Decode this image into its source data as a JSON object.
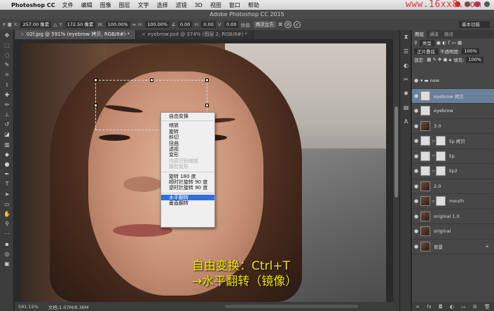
{
  "menubar": {
    "apple_icon": "apple-icon",
    "app_name": "Photoshop CC",
    "items": [
      "文件",
      "编辑",
      "图像",
      "图层",
      "文字",
      "选择",
      "滤镜",
      "3D",
      "视图",
      "窗口",
      "帮助"
    ],
    "watermark": "www.16xx8.com"
  },
  "titlebar": {
    "title": "Adobe Photoshop CC 2015"
  },
  "options": {
    "x_label": "X:",
    "x_value": "257.00 像素",
    "y_label": "Y:",
    "y_value": "172.50 像素",
    "w_label": "W:",
    "w_value": "100.00%",
    "h_label": "H:",
    "h_value": "100.00%",
    "angle_value": "0.00",
    "hs_label": "H:",
    "hs_value": "0.00",
    "v_label": "V:",
    "v_value": "0.00",
    "interp_label": "插值:",
    "interp_value": "两次立方",
    "workspace": "基本功能"
  },
  "tabs": [
    {
      "label": "02f.jpg @ 591% (eyebrow 拷贝, RGB/8#) *",
      "active": true
    },
    {
      "label": "eyebrow.psd @ 374% (图层 2, RGB/8#) *",
      "active": false
    }
  ],
  "context_menu": {
    "items": [
      {
        "label": "自由变换",
        "state": "normal"
      },
      {
        "sep": true
      },
      {
        "label": "缩放",
        "state": "normal"
      },
      {
        "label": "旋转",
        "state": "normal"
      },
      {
        "label": "斜切",
        "state": "normal"
      },
      {
        "label": "扭曲",
        "state": "normal"
      },
      {
        "label": "透视",
        "state": "normal"
      },
      {
        "label": "变形",
        "state": "normal"
      },
      {
        "label": "内容识别缩放",
        "state": "disabled"
      },
      {
        "label": "操控变形",
        "state": "disabled"
      },
      {
        "sep": true
      },
      {
        "label": "旋转 180 度",
        "state": "normal"
      },
      {
        "label": "顺时针旋转 90 度",
        "state": "normal"
      },
      {
        "label": "逆时针旋转 90 度",
        "state": "normal"
      },
      {
        "sep": true
      },
      {
        "label": "水平翻转",
        "state": "highlighted"
      },
      {
        "label": "垂直翻转",
        "state": "normal"
      }
    ]
  },
  "caption": {
    "line1": "自由变换：Ctrl+T",
    "line2": "→水平翻转（镜像）"
  },
  "statusbar": {
    "zoom": "591.15%",
    "doc": "文档:1.07M/8.36M"
  },
  "panel": {
    "tabs": [
      "图层",
      "通道",
      "路径"
    ],
    "kind": "类型",
    "blend": "正片叠底",
    "opacity_label": "不透明度:",
    "opacity": "100%",
    "lock_label": "锁定:",
    "fill_label": "填充:",
    "fill": "100%",
    "layers": [
      {
        "name": "new",
        "type": "group",
        "active": false,
        "lock": false,
        "dark": false,
        "chain": false
      },
      {
        "name": "eyebrow 拷贝",
        "type": "layer",
        "active": true,
        "lock": false,
        "dark": false,
        "chain": false
      },
      {
        "name": "eyebrow",
        "type": "layer",
        "active": false,
        "lock": false,
        "dark": false,
        "chain": false
      },
      {
        "name": "3.0",
        "type": "layer",
        "active": false,
        "lock": false,
        "dark": true,
        "chain": false
      },
      {
        "name": "lip 拷贝",
        "type": "layer",
        "active": false,
        "lock": false,
        "dark": false,
        "chain": true
      },
      {
        "name": "lip",
        "type": "layer",
        "active": false,
        "lock": false,
        "dark": false,
        "chain": true
      },
      {
        "name": "lip2",
        "type": "layer",
        "active": false,
        "lock": false,
        "dark": false,
        "chain": true
      },
      {
        "name": "2.0",
        "type": "layer",
        "active": false,
        "lock": false,
        "dark": true,
        "chain": false
      },
      {
        "name": "mouth",
        "type": "layer",
        "active": false,
        "lock": false,
        "dark": true,
        "chain": true
      },
      {
        "name": "original 1.0",
        "type": "layer",
        "active": false,
        "lock": false,
        "dark": true,
        "chain": false
      },
      {
        "name": "original",
        "type": "layer",
        "active": false,
        "lock": false,
        "dark": true,
        "chain": false
      },
      {
        "name": "背景",
        "type": "layer",
        "active": false,
        "lock": true,
        "dark": true,
        "chain": false
      }
    ]
  }
}
